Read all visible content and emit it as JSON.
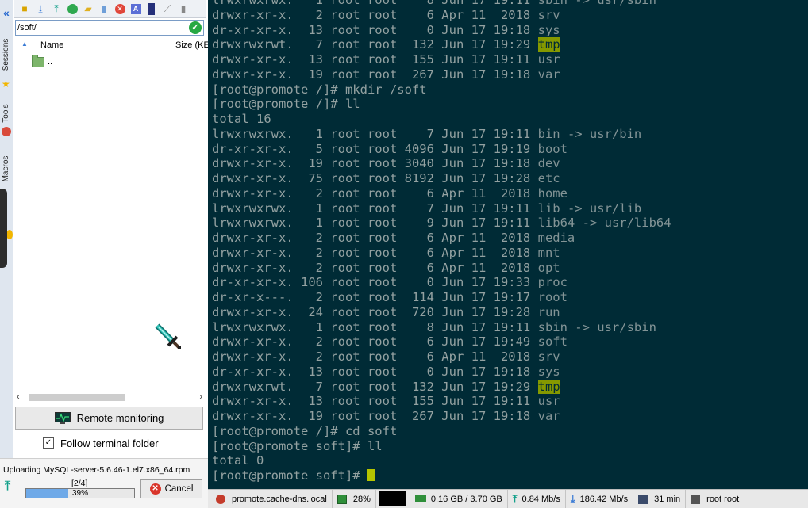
{
  "sidebar": {
    "tabs": [
      {
        "label": "Sessions",
        "icon": "star-icon"
      },
      {
        "label": "Tools",
        "icon": "tools-icon"
      },
      {
        "label": "Macros",
        "icon": "macros-icon"
      }
    ]
  },
  "file_browser": {
    "path": "/soft/",
    "columns": {
      "name": "Name",
      "size": "Size (KE"
    },
    "items": [
      {
        "name": ".."
      }
    ],
    "remote_monitoring_label": "Remote monitoring",
    "follow_terminal_label": "Follow terminal folder",
    "follow_terminal_checked": true
  },
  "upload": {
    "text": "Uploading MySQL-server-5.6.46-1.el7.x86_64.rpm",
    "count": "[2/4]",
    "progress_percent": 39,
    "progress_label": "39%",
    "cancel_label": "Cancel"
  },
  "terminal": {
    "colors": {
      "background": "#002b36",
      "text": "#93a1a1",
      "highlight": "#859900"
    },
    "lines": [
      {
        "prefix": "lrwxrwxrwx.   1 root root    8 Jun 17 19:11 ",
        "name": "sbin",
        "suffix": " -> usr/sbin"
      },
      {
        "prefix": "drwxr-xr-x.   2 root root    6 Apr 11  2018 ",
        "name": "srv"
      },
      {
        "prefix": "dr-xr-xr-x.  13 root root    0 Jun 17 19:18 ",
        "name": "sys"
      },
      {
        "prefix": "drwxrwxrwt.   7 root root  132 Jun 17 19:29 ",
        "name": "tmp",
        "highlight": true
      },
      {
        "prefix": "drwxr-xr-x.  13 root root  155 Jun 17 19:11 ",
        "name": "usr"
      },
      {
        "prefix": "drwxr-xr-x.  19 root root  267 Jun 17 19:18 ",
        "name": "var"
      },
      {
        "prefix": "[root@promote /]# mkdir /soft"
      },
      {
        "prefix": "[root@promote /]# ll"
      },
      {
        "prefix": "total 16"
      },
      {
        "prefix": "lrwxrwxrwx.   1 root root    7 Jun 17 19:11 ",
        "name": "bin",
        "suffix": " -> usr/bin"
      },
      {
        "prefix": "dr-xr-xr-x.   5 root root 4096 Jun 17 19:19 ",
        "name": "boot"
      },
      {
        "prefix": "drwxr-xr-x.  19 root root 3040 Jun 17 19:18 ",
        "name": "dev"
      },
      {
        "prefix": "drwxr-xr-x.  75 root root 8192 Jun 17 19:28 ",
        "name": "etc"
      },
      {
        "prefix": "drwxr-xr-x.   2 root root    6 Apr 11  2018 ",
        "name": "home"
      },
      {
        "prefix": "lrwxrwxrwx.   1 root root    7 Jun 17 19:11 ",
        "name": "lib",
        "suffix": " -> usr/lib"
      },
      {
        "prefix": "lrwxrwxrwx.   1 root root    9 Jun 17 19:11 ",
        "name": "lib64",
        "suffix": " -> usr/lib64"
      },
      {
        "prefix": "drwxr-xr-x.   2 root root    6 Apr 11  2018 ",
        "name": "media"
      },
      {
        "prefix": "drwxr-xr-x.   2 root root    6 Apr 11  2018 ",
        "name": "mnt"
      },
      {
        "prefix": "drwxr-xr-x.   2 root root    6 Apr 11  2018 ",
        "name": "opt"
      },
      {
        "prefix": "dr-xr-xr-x. 106 root root    0 Jun 17 19:33 ",
        "name": "proc"
      },
      {
        "prefix": "dr-xr-x---.   2 root root  114 Jun 17 19:17 ",
        "name": "root"
      },
      {
        "prefix": "drwxr-xr-x.  24 root root  720 Jun 17 19:28 ",
        "name": "run"
      },
      {
        "prefix": "lrwxrwxrwx.   1 root root    8 Jun 17 19:11 ",
        "name": "sbin",
        "suffix": " -> usr/sbin"
      },
      {
        "prefix": "drwxr-xr-x.   2 root root    6 Jun 17 19:49 ",
        "name": "soft"
      },
      {
        "prefix": "drwxr-xr-x.   2 root root    6 Apr 11  2018 ",
        "name": "srv"
      },
      {
        "prefix": "dr-xr-xr-x.  13 root root    0 Jun 17 19:18 ",
        "name": "sys"
      },
      {
        "prefix": "drwxrwxrwt.   7 root root  132 Jun 17 19:29 ",
        "name": "tmp",
        "highlight": true
      },
      {
        "prefix": "drwxr-xr-x.  13 root root  155 Jun 17 19:11 ",
        "name": "usr"
      },
      {
        "prefix": "drwxr-xr-x.  19 root root  267 Jun 17 19:18 ",
        "name": "var"
      },
      {
        "prefix": "[root@promote /]# cd soft"
      },
      {
        "prefix": "[root@promote soft]# ll"
      },
      {
        "prefix": "total 0"
      },
      {
        "prefix": "[root@promote soft]# ",
        "cursor": true
      }
    ]
  },
  "statusbar": {
    "host": "promote.cache-dns.local",
    "cpu": "28%",
    "memory": "0.16 GB / 3.70 GB",
    "upload_speed": "0.84 Mb/s",
    "download_speed": "186.42 Mb/s",
    "uptime": "31 min",
    "user": "root  root"
  }
}
